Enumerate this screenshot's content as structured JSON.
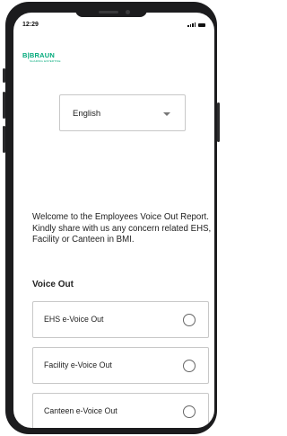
{
  "status": {
    "time": "12:29"
  },
  "brand": {
    "name": "B|BRAUN",
    "tagline": "SHARING EXPERTISE"
  },
  "language": {
    "selected": "English"
  },
  "intro": {
    "text": "Welcome to the Employees Voice Out Report. Kindly share with us any concern related EHS, Facility or Canteen in BMI."
  },
  "voice_out": {
    "title": "Voice Out",
    "options": [
      {
        "label": "EHS e-Voice Out",
        "selected": false
      },
      {
        "label": "Facility e-Voice Out",
        "selected": false
      },
      {
        "label": "Canteen e-Voice Out",
        "selected": false
      }
    ]
  }
}
